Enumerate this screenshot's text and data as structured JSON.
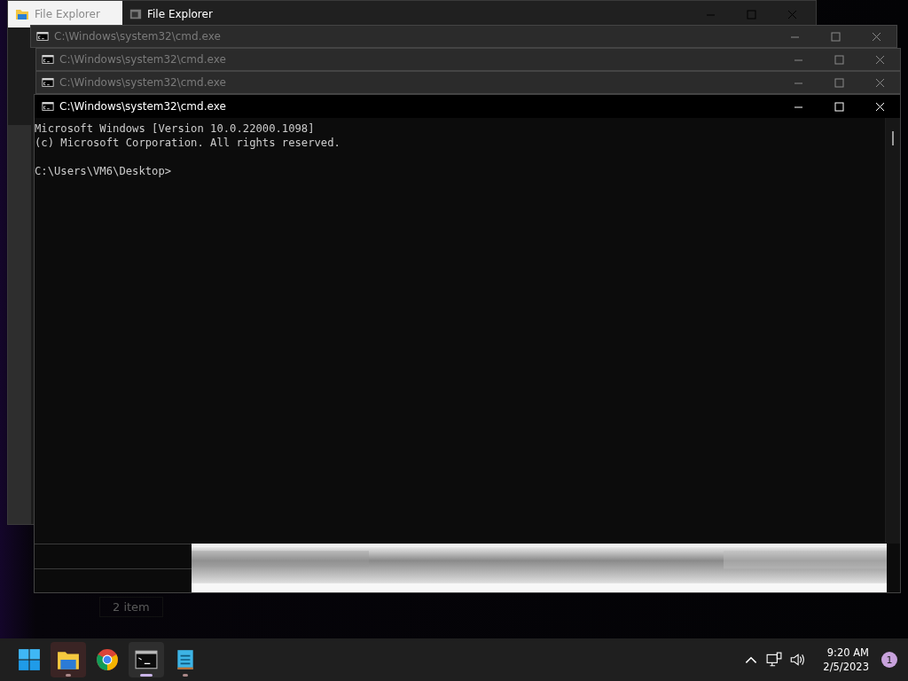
{
  "file_explorer": {
    "tab": {
      "label": "File Explorer",
      "selected": true
    },
    "title": "File Explorer",
    "status_text": "2 item"
  },
  "cmd_windows": [
    {
      "title": "C:\\Windows\\system32\\cmd.exe",
      "active": false
    },
    {
      "title": "C:\\Windows\\system32\\cmd.exe",
      "active": false
    },
    {
      "title": "C:\\Windows\\system32\\cmd.exe",
      "active": false
    },
    {
      "title": "C:\\Windows\\system32\\cmd.exe",
      "active": true
    }
  ],
  "console": {
    "header_lines": [
      "Microsoft Windows [Version 10.0.22000.1098]",
      "(c) Microsoft Corporation. All rights reserved."
    ],
    "prompt": "C:\\Users\\VM6\\Desktop>"
  },
  "taskbar": {
    "apps": [
      {
        "kind": "start",
        "running": false,
        "selected": false,
        "attention": false
      },
      {
        "kind": "explorer",
        "running": true,
        "selected": false,
        "attention": true
      },
      {
        "kind": "chrome",
        "running": false,
        "selected": false,
        "attention": false
      },
      {
        "kind": "terminal",
        "running": true,
        "selected": true,
        "attention": false
      },
      {
        "kind": "notepad",
        "running": true,
        "selected": false,
        "attention": false
      }
    ],
    "time": "9:20 AM",
    "date": "2/5/2023",
    "notification_count": "1"
  }
}
